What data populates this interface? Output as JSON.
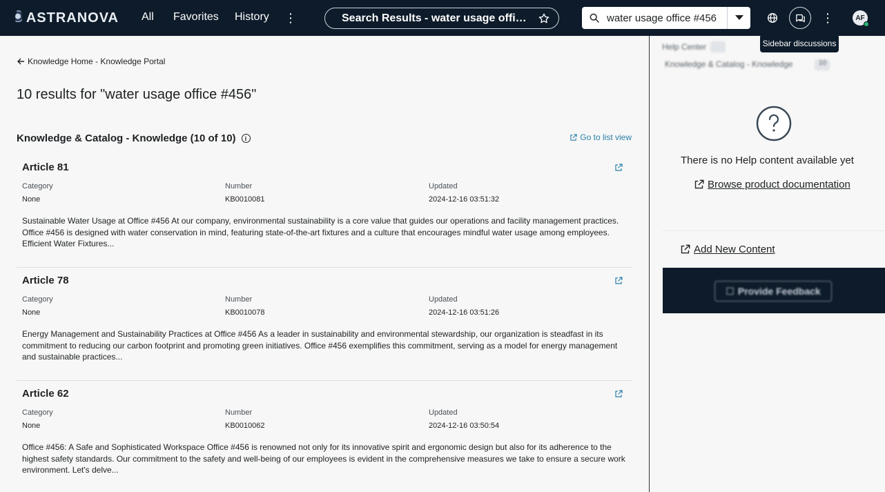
{
  "topbar": {
    "logo_text": "ASTRANOVA",
    "nav": [
      "All",
      "Favorites",
      "History"
    ],
    "page_title": "Search Results - water usage office #…",
    "search_value": "water usage office #456",
    "avatar_initials": "AF",
    "tooltip": "Sidebar discussions"
  },
  "main": {
    "breadcrumb": "Knowledge Home - Knowledge Portal",
    "results_title": "10 results for \"water usage office #456\"",
    "section_title": "Knowledge & Catalog - Knowledge (10 of 10)",
    "list_view_label": "Go to list view",
    "field_labels": {
      "category": "Category",
      "number": "Number",
      "updated": "Updated"
    },
    "articles": [
      {
        "title": "Article 81",
        "category": "None",
        "number": "KB0010081",
        "updated": "2024-12-16 03:51:32",
        "desc": "Sustainable Water Usage at Office #456 At our company, environmental sustainability is a core value that guides our operations and facility management practices. Office #456 is designed with water conservation in mind, featuring state-of-the-art fixtures and a culture that encourages mindful water usage among employees. Efficient Water Fixtures..."
      },
      {
        "title": "Article 78",
        "category": "None",
        "number": "KB0010078",
        "updated": "2024-12-16 03:51:26",
        "desc": "Energy Management and Sustainability Practices at Office #456 As a leader in sustainability and environmental stewardship, our organization is steadfast in its commitment to reducing our carbon footprint and promoting green initiatives. Office #456 exemplifies this commitment, serving as a model for energy management and sustainable practices..."
      },
      {
        "title": "Article 62",
        "category": "None",
        "number": "KB0010062",
        "updated": "2024-12-16 03:50:54",
        "desc": "Office #456: A Safe and Sophisticated Workspace Office #456 is renowned not only for its innovative spirit and ergonomic design but also for its adherence to the highest safety standards. Our commitment to the safety and well-being of our employees is evident in the comprehensive measures we take to ensure a secure work environment. Let's delve..."
      }
    ]
  },
  "sidebar": {
    "crumb_1": "Help Center",
    "crumb_2": "Knowledge & Catalog - Knowledge",
    "crumb_2_count": "10",
    "no_help_text": "There is no Help content available yet",
    "browse_label": "Browse product documentation",
    "add_new_label": "Add New Content",
    "feedback_label": "Provide Feedback"
  },
  "colors": {
    "nav_bg": "#0d1b2a",
    "link": "#2a7fa8",
    "status_online": "#2bb673"
  }
}
